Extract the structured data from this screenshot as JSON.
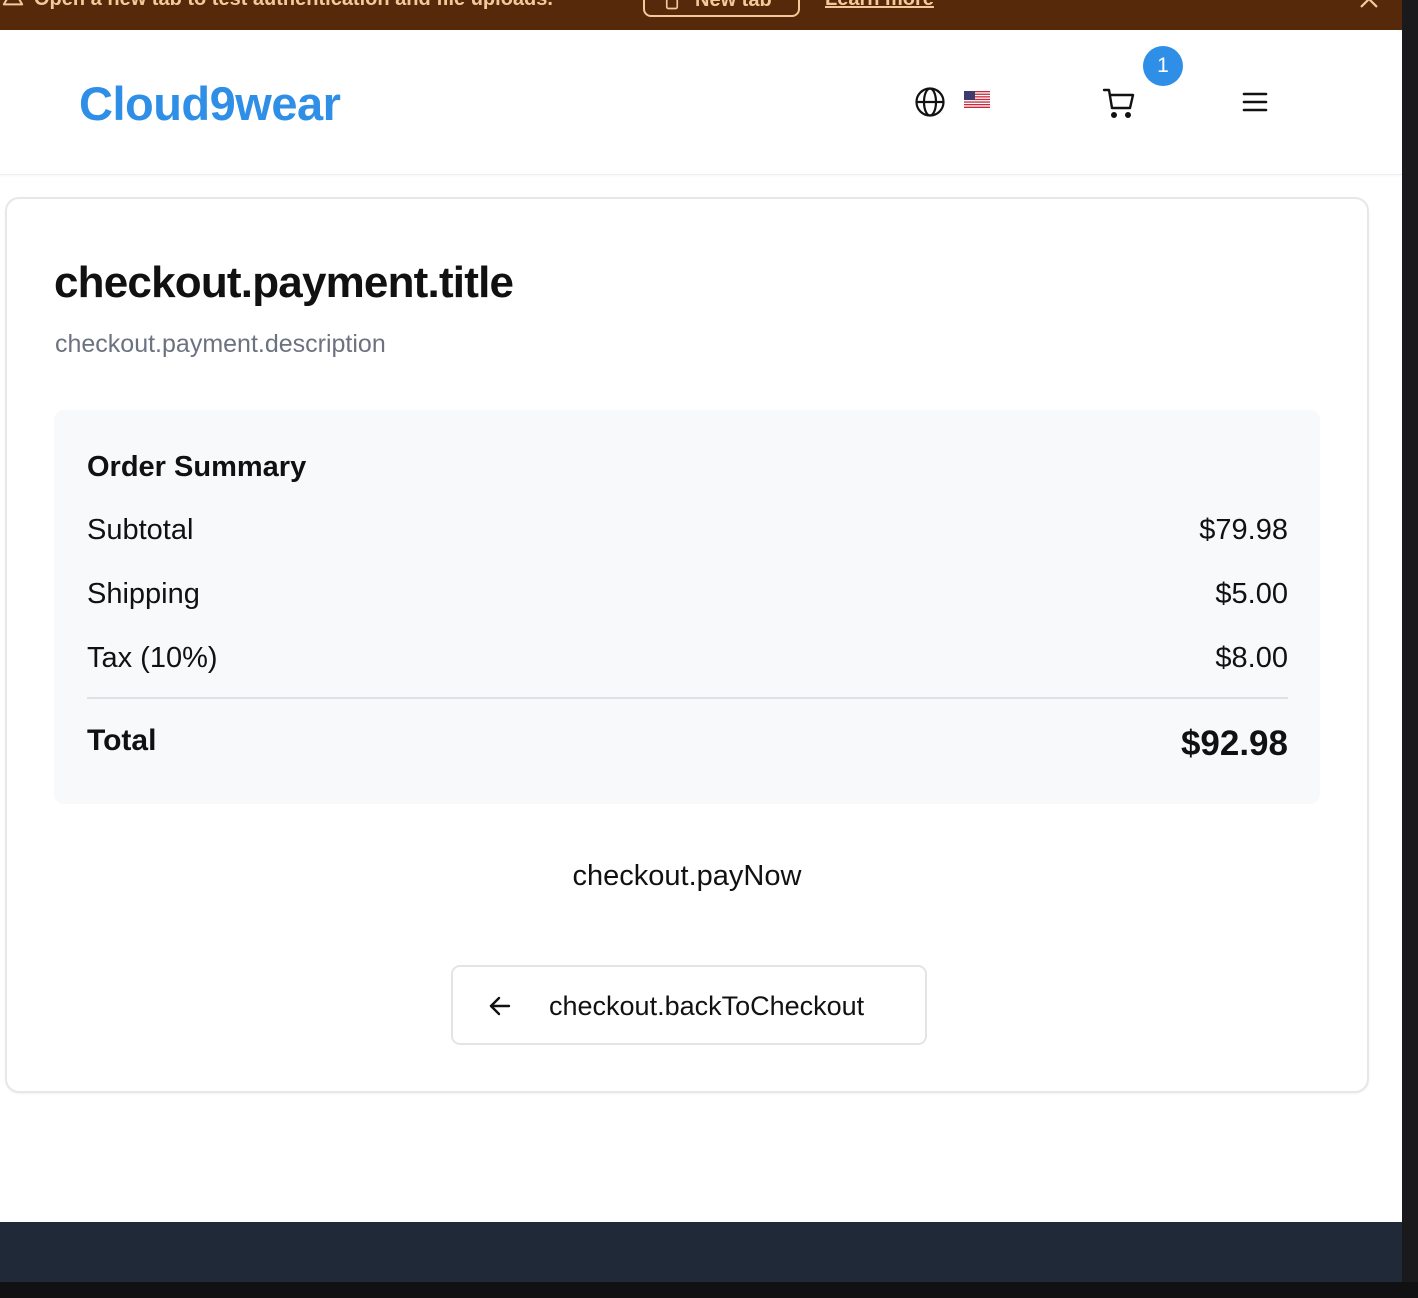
{
  "banner": {
    "message": "Open a new tab to test authentication and file uploads.",
    "new_tab_label": "New tab",
    "learn_more_label": "Learn more"
  },
  "header": {
    "logo": "Cloud9wear",
    "cart_count": "1",
    "flag": "🇺🇸",
    "icons": [
      "globe-icon",
      "flag-icon",
      "cart-icon",
      "menu-icon"
    ]
  },
  "page": {
    "title": "checkout.payment.title",
    "description": "checkout.payment.description"
  },
  "summary": {
    "title": "Order Summary",
    "rows": [
      {
        "label": "Subtotal",
        "value": "$79.98"
      },
      {
        "label": "Shipping",
        "value": "$5.00"
      },
      {
        "label": "Tax (10%)",
        "value": "$8.00"
      }
    ],
    "total_label": "Total",
    "total_value": "$92.98"
  },
  "actions": {
    "pay_now": "checkout.payNow",
    "back_to_checkout": "checkout.backToCheckout"
  },
  "colors": {
    "brand": "#2f8fe6",
    "banner_bg": "#55290a",
    "banner_text": "#f3c99a",
    "footer_bg": "#1f2937"
  }
}
